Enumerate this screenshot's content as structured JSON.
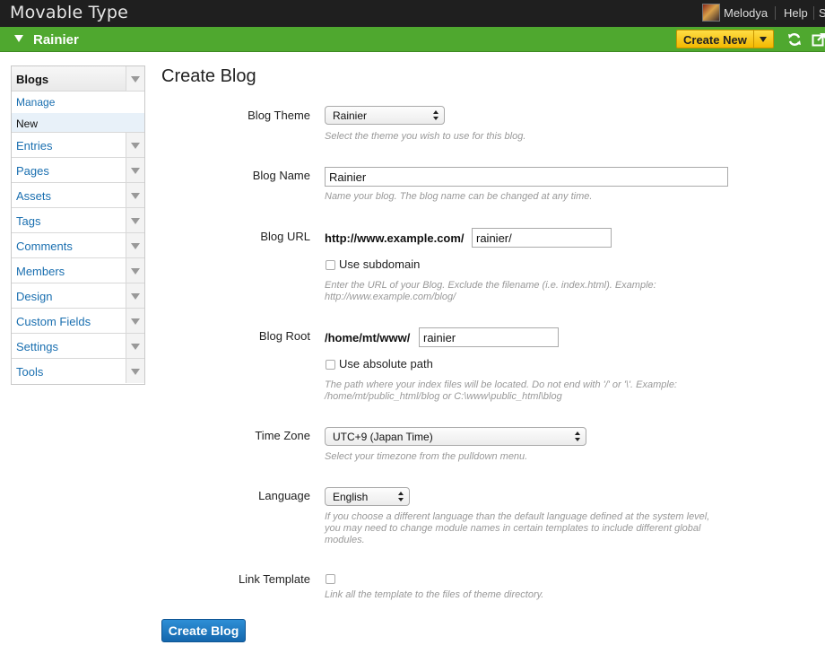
{
  "app": {
    "logo": "Movable Type",
    "user_name": "Melodya",
    "help_label": "Help",
    "truncated_label": "S"
  },
  "blogbar": {
    "blog_name": "Rainier",
    "create_new_label": "Create New"
  },
  "sidebar": {
    "header": "Blogs",
    "sub_items": [
      {
        "label": "Manage"
      },
      {
        "label": "New"
      }
    ],
    "items": [
      {
        "label": "Entries"
      },
      {
        "label": "Pages"
      },
      {
        "label": "Assets"
      },
      {
        "label": "Tags"
      },
      {
        "label": "Comments"
      },
      {
        "label": "Members"
      },
      {
        "label": "Design"
      },
      {
        "label": "Custom Fields"
      },
      {
        "label": "Settings"
      },
      {
        "label": "Tools"
      }
    ]
  },
  "page": {
    "title": "Create Blog",
    "submit_label": "Create Blog"
  },
  "form": {
    "theme": {
      "label": "Blog Theme",
      "value": "Rainier",
      "hint": "Select the theme you wish to use for this blog."
    },
    "name": {
      "label": "Blog Name",
      "value": "Rainier",
      "hint": "Name your blog. The blog name can be changed at any time."
    },
    "url": {
      "label": "Blog URL",
      "prefix": "http://www.example.com/",
      "value": "rainier/",
      "checkbox_label": "Use subdomain",
      "hint": "Enter the URL of your Blog. Exclude the filename (i.e. index.html). Example: http://www.example.com/blog/"
    },
    "root": {
      "label": "Blog Root",
      "prefix": "/home/mt/www/",
      "value": "rainier",
      "checkbox_label": "Use absolute path",
      "hint": "The path where your index files will be located. Do not end with '/' or '\\'. Example: /home/mt/public_html/blog or C:\\www\\public_html\\blog"
    },
    "timezone": {
      "label": "Time Zone",
      "value": "UTC+9 (Japan Time)",
      "hint": "Select your timezone from the pulldown menu."
    },
    "language": {
      "label": "Language",
      "value": "English",
      "hint": "If you choose a different language than the default language defined at the system level, you may need to change module names in certain templates to include different global modules."
    },
    "link_template": {
      "label": "Link Template",
      "hint": "Link all the template to the files of theme directory."
    }
  },
  "colors": {
    "topbar": "#1f1f1f",
    "blogbar": "#4fa82f",
    "create_new": "#f2b800",
    "link": "#1a6fb0",
    "primary_button": "#1a74bd"
  }
}
